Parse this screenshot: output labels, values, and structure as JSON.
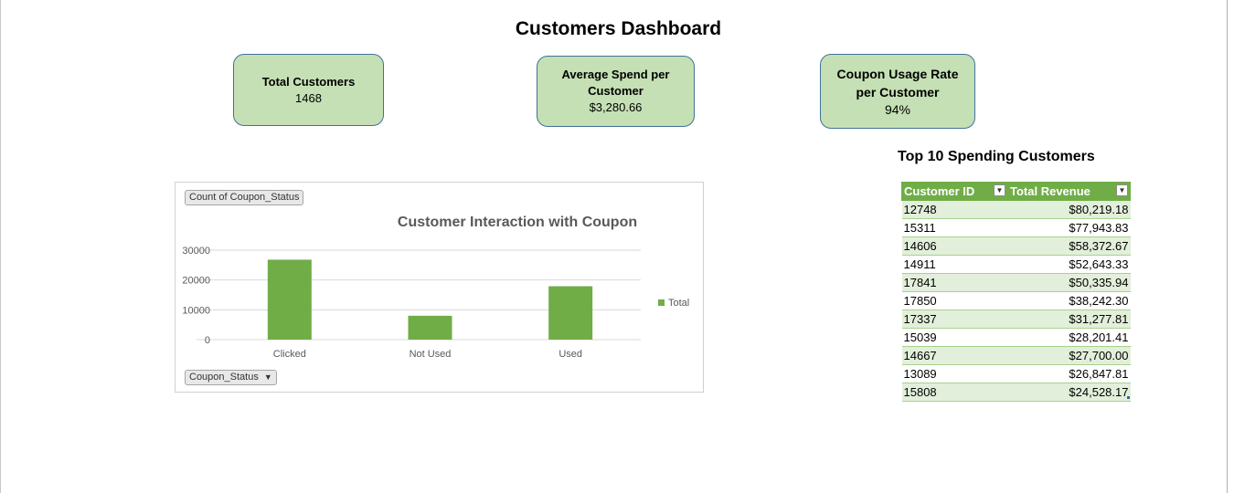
{
  "dashboard": {
    "title": "Customers Dashboard"
  },
  "kpis": [
    {
      "label": "Total Customers",
      "value": "1468"
    },
    {
      "label_line1": "Average Spend per",
      "label_line2": "Customer",
      "value": "$3,280.66"
    },
    {
      "label_line1": "Coupon Usage Rate",
      "label_line2": "per Customer",
      "value": "94%"
    }
  ],
  "chart_controls": {
    "value_field": "Count of Coupon_Status",
    "axis_field": "Coupon_Status"
  },
  "chart_data": {
    "type": "bar",
    "title": "Customer Interaction with Coupon",
    "categories": [
      "Clicked",
      "Not Used",
      "Used"
    ],
    "series": [
      {
        "name": "Total",
        "values": [
          26800,
          8000,
          17900
        ],
        "color": "#70ad47"
      }
    ],
    "yticks": [
      "0",
      "10000",
      "20000",
      "30000"
    ],
    "ylim": [
      0,
      30000
    ],
    "grid": true,
    "legend": "right"
  },
  "top_customers": {
    "title": "Top 10 Spending Customers",
    "columns": [
      "Customer ID",
      "Total Revenue"
    ],
    "rows": [
      [
        "12748",
        "$80,219.18"
      ],
      [
        "15311",
        "$77,943.83"
      ],
      [
        "14606",
        "$58,372.67"
      ],
      [
        "14911",
        "$52,643.33"
      ],
      [
        "17841",
        "$50,335.94"
      ],
      [
        "17850",
        "$38,242.30"
      ],
      [
        "17337",
        "$31,277.81"
      ],
      [
        "15039",
        "$28,201.41"
      ],
      [
        "14667",
        "$27,700.00"
      ],
      [
        "13089",
        "$26,847.81"
      ],
      [
        "15808",
        "$24,528.17"
      ]
    ]
  }
}
